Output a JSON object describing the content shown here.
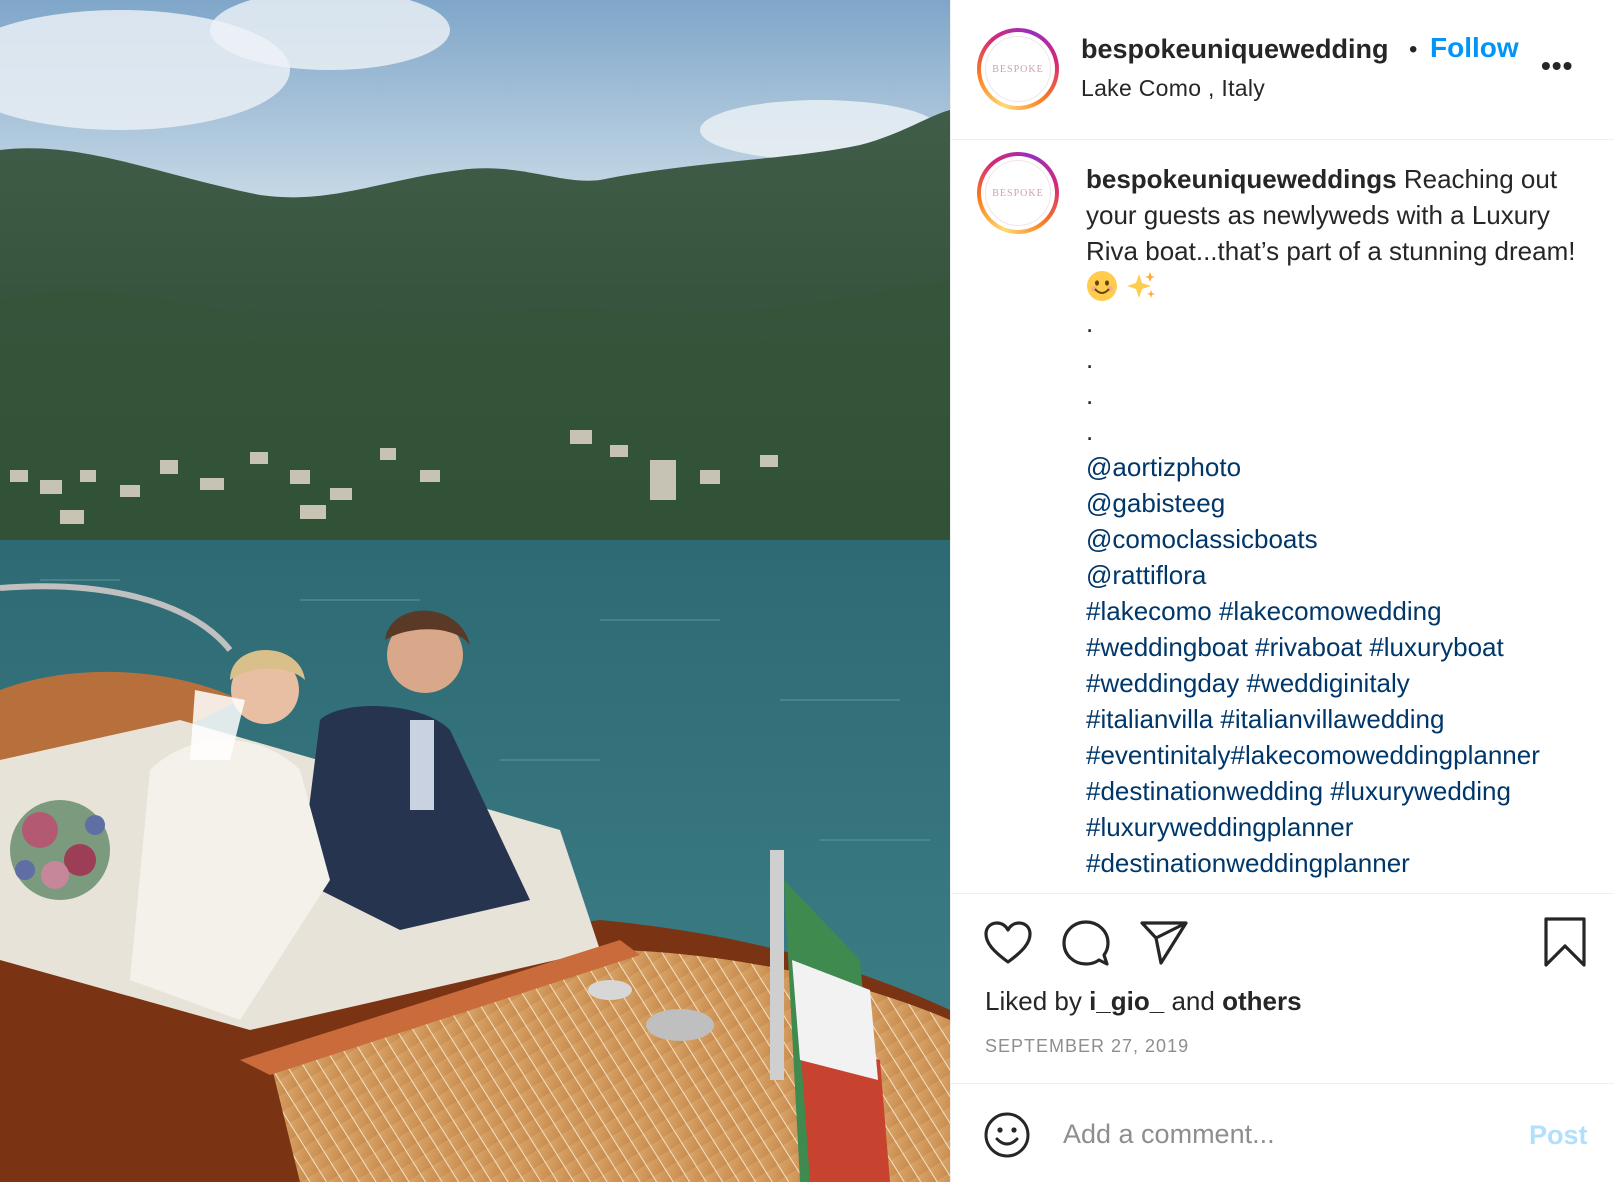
{
  "post": {
    "username": "bespokeuniquewedding",
    "location": "Lake Como , Italy",
    "follow_label": "Follow",
    "separator": "•",
    "more_label": "•••",
    "avatar_text": "BESPOKE"
  },
  "caption": {
    "username": "bespokeuniqueweddings",
    "text": "Reaching out your guests as newlyweds with a Luxury Riva boat...that’s part of a stunning dream!",
    "emojis": [
      "smiling-face-emoji",
      "sparkles-emoji"
    ],
    "dots": [
      ".",
      ".",
      ".",
      "."
    ],
    "mentions": [
      "@aortizphoto",
      "@gabisteeg",
      "@comoclassicboats",
      "@rattiflora"
    ],
    "hashtag_lines": [
      "#lakecomo #lakecomowedding",
      "#weddingboat #rivaboat #luxuryboat",
      "#weddingday #weddiginitaly",
      "#italianvilla #italianvillawedding",
      "#eventinitaly#lakecomoweddingplanner",
      "#destinationwedding #luxurywedding",
      "#luxuryweddingplanner",
      "#destinationweddingplanner"
    ]
  },
  "actions": {
    "icons": [
      "heart-icon",
      "comment-icon",
      "share-icon",
      "bookmark-icon"
    ],
    "liked_by_prefix": "Liked by",
    "liked_by_user": "i_gio_",
    "liked_by_and": "and",
    "liked_by_others": "others",
    "date": "SEPTEMBER 27, 2019"
  },
  "comment": {
    "placeholder": "Add a comment...",
    "post_label": "Post"
  },
  "colors": {
    "link": "#00376b",
    "follow": "#0095f6",
    "post_disabled": "#b2dffc",
    "muted": "#8e8e8e"
  }
}
